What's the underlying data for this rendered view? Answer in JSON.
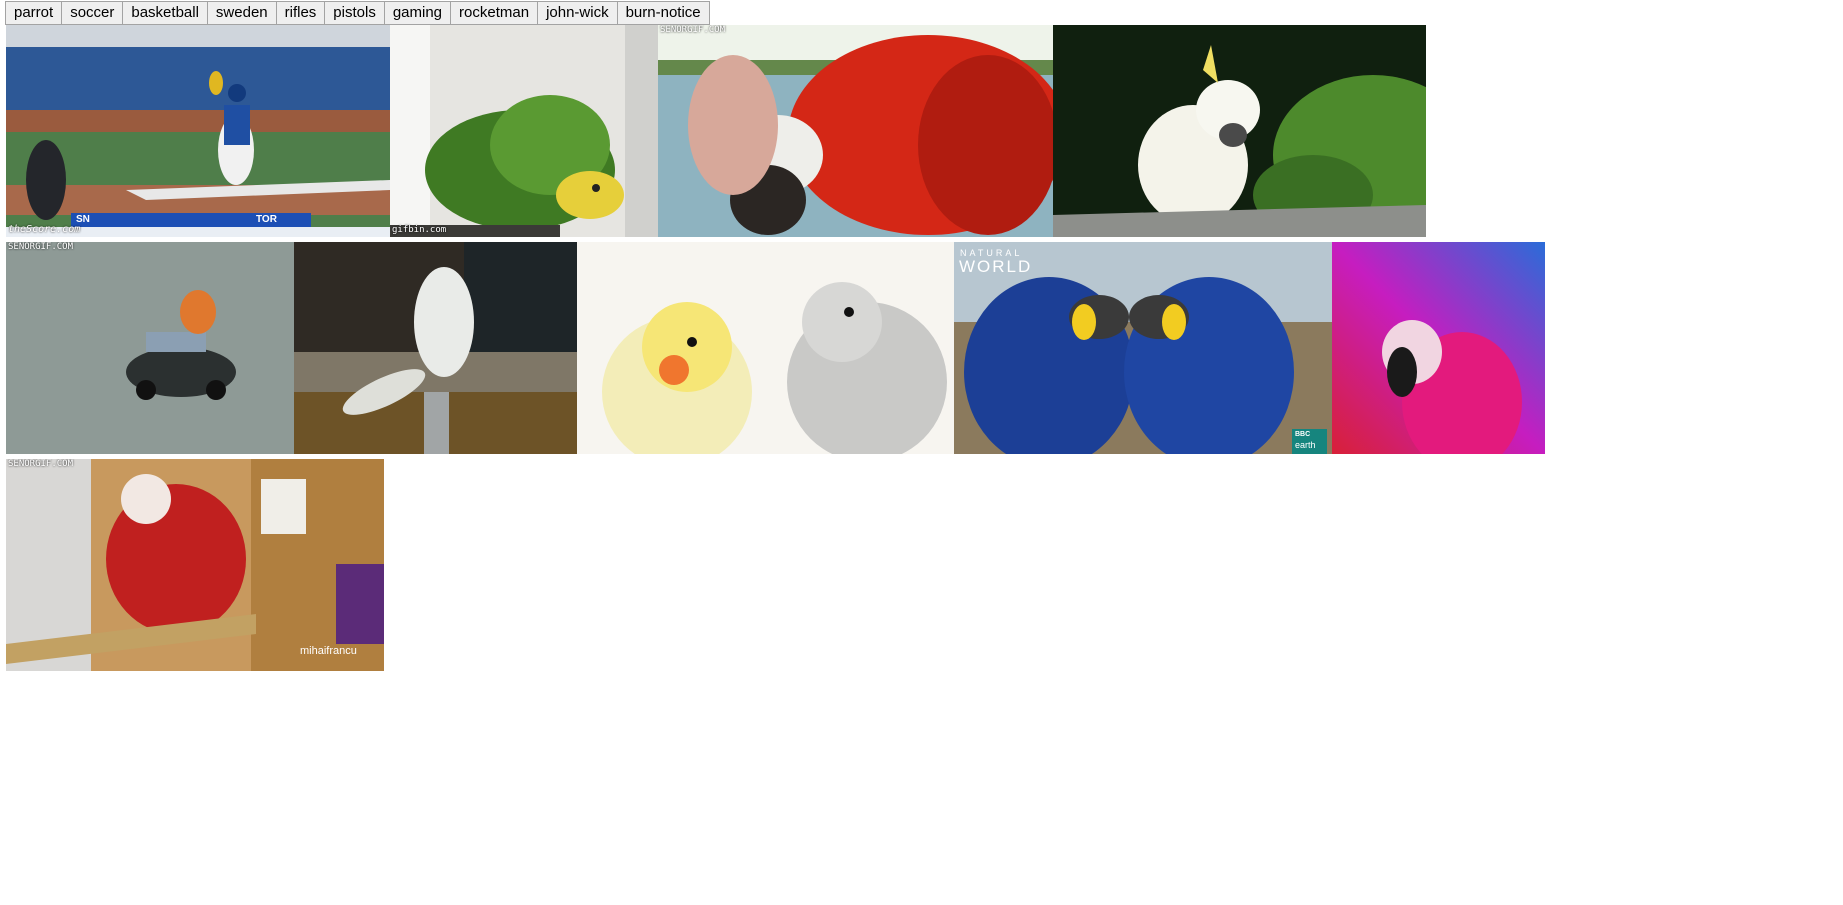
{
  "tabs": [
    "parrot",
    "soccer",
    "basketball",
    "sweden",
    "rifles",
    "pistols",
    "gaming",
    "rocketman",
    "john-wick",
    "burn-notice"
  ],
  "gifs": {
    "baseball": {
      "watermark": "theScore.com",
      "score_network": "SN",
      "team": "TOR"
    },
    "green_parrot": {
      "watermark": "gifbin.com"
    },
    "scarlet_macaw": {
      "watermark": "SENORGIF.COM"
    },
    "cockatoo": {},
    "parrot_car": {
      "watermark": "SENORGIF.COM"
    },
    "dancing_cockatoo": {},
    "cockatiels": {},
    "hyacinth": {
      "brand_line1": "NATURAL",
      "brand_line2": "WORLD",
      "badge_line1": "BBC",
      "badge_line2": "earth"
    },
    "pink_macaw": {},
    "classroom_macaw": {
      "watermark": "SENORGIF.COM",
      "credit": "mihaifrancu"
    }
  }
}
